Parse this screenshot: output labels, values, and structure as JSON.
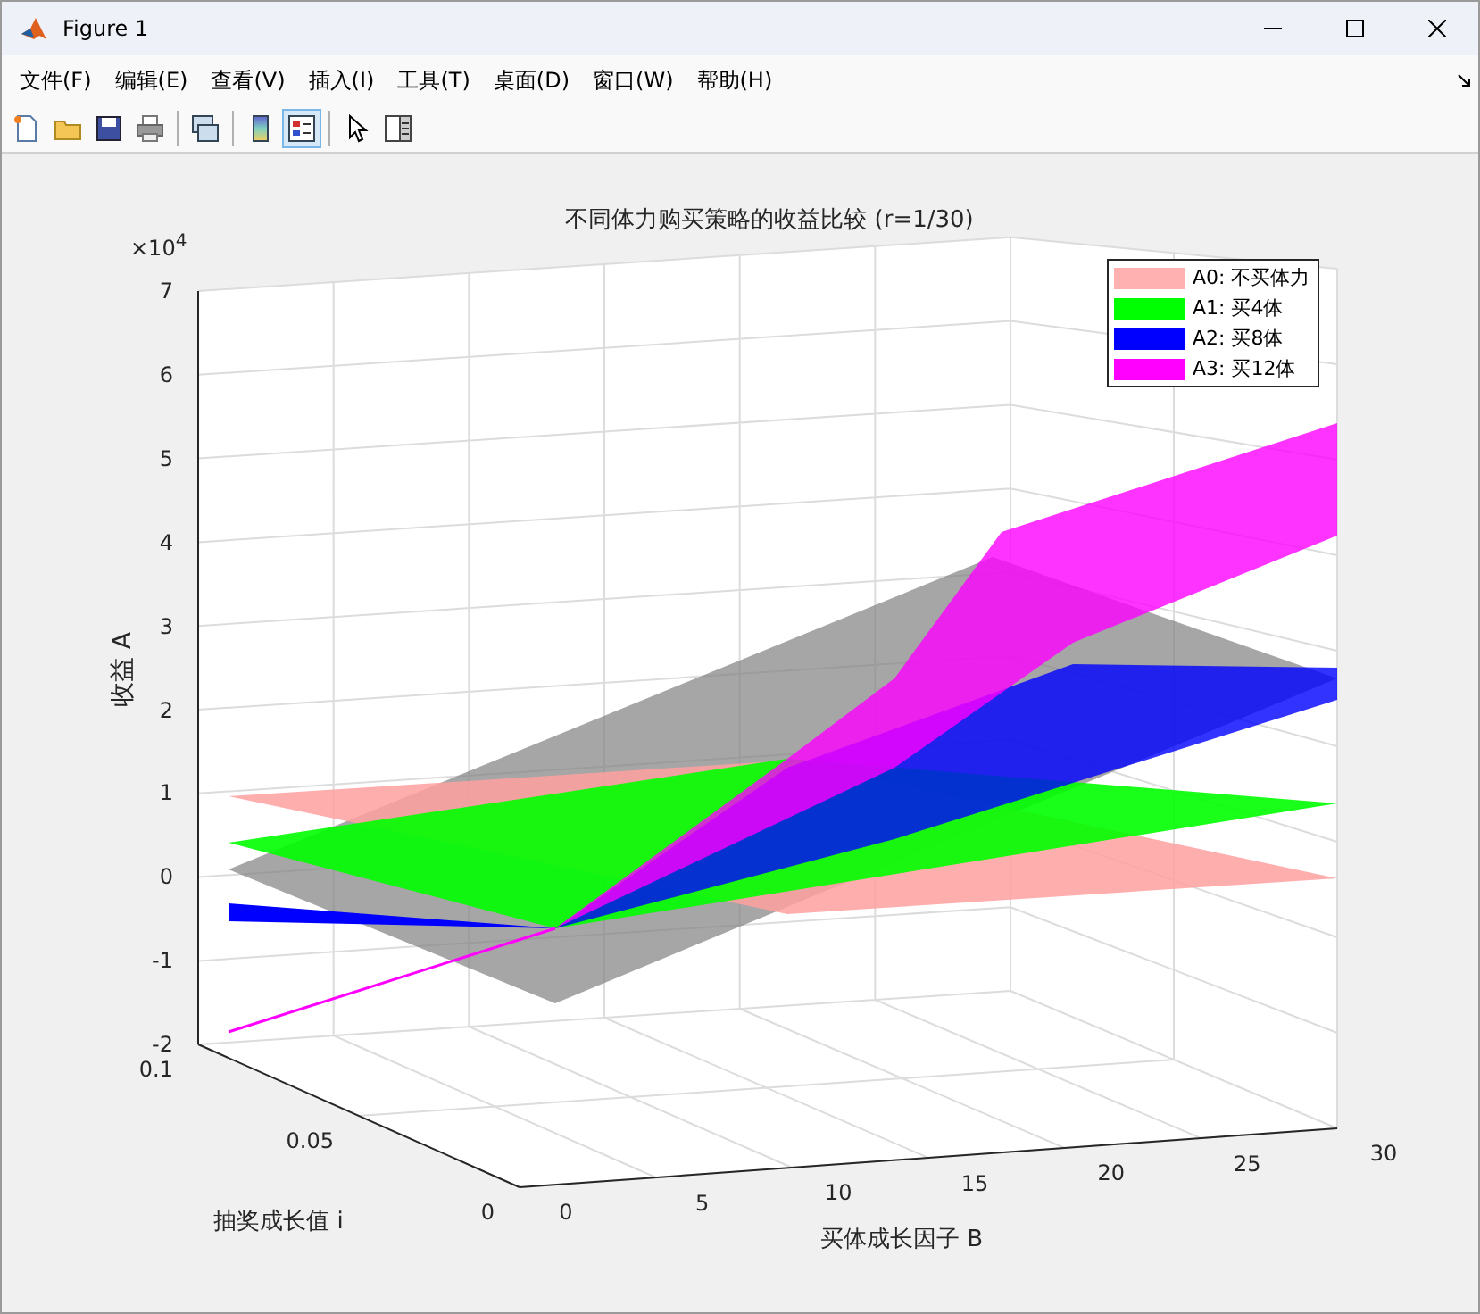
{
  "window": {
    "title": "Figure 1"
  },
  "menu": [
    "文件(F)",
    "编辑(E)",
    "查看(V)",
    "插入(I)",
    "工具(T)",
    "桌面(D)",
    "窗口(W)",
    "帮助(H)"
  ],
  "toolbar": [
    {
      "kind": "new",
      "pressed": false
    },
    {
      "kind": "open",
      "pressed": false
    },
    {
      "kind": "save",
      "pressed": false
    },
    {
      "kind": "print",
      "pressed": false
    },
    {
      "kind": "sep"
    },
    {
      "kind": "link",
      "pressed": false
    },
    {
      "kind": "sep"
    },
    {
      "kind": "colorbar",
      "pressed": false
    },
    {
      "kind": "legend",
      "pressed": true
    },
    {
      "kind": "sep"
    },
    {
      "kind": "pointer",
      "pressed": false
    },
    {
      "kind": "inspector",
      "pressed": false
    }
  ],
  "figure": {
    "title": "不同体力购买策略的收益比较 (r=1/30)",
    "multiplier": "×10$^{4}$",
    "zlabel": "收益 A",
    "ylabel": "抽奖成长值 i",
    "xlabel": "买体成长因子 B",
    "zticks": [
      "7",
      "6",
      "5",
      "4",
      "3",
      "2",
      "1",
      "0",
      "-1",
      "-2"
    ],
    "yticks": [
      "0.1",
      "0.05",
      "0"
    ],
    "xticks": [
      "0",
      "5",
      "10",
      "15",
      "20",
      "25",
      "30"
    ],
    "legend": [
      {
        "label": "A0: 不买体力",
        "color": "#ffb0b0"
      },
      {
        "label": "A1: 买4体",
        "color": "#00ff00"
      },
      {
        "label": "A2: 买8体",
        "color": "#0000ff"
      },
      {
        "label": "A3: 买12体",
        "color": "#ff00ff"
      }
    ]
  }
}
